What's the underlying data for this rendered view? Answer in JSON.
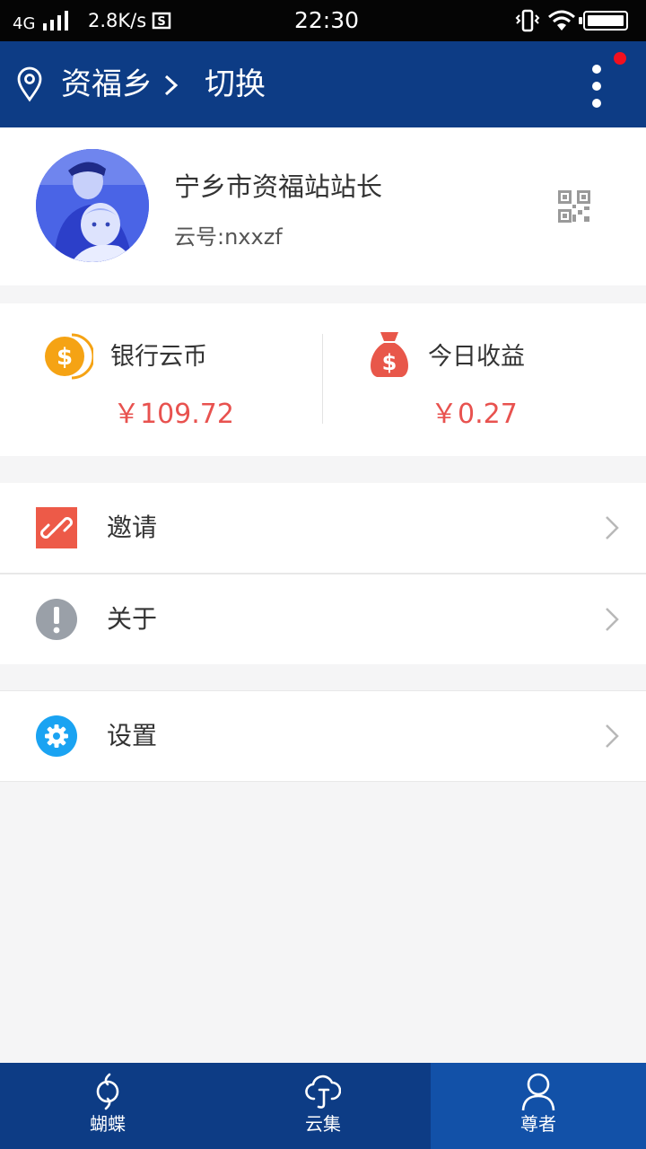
{
  "status_bar": {
    "network": "4G",
    "speed": "2.8K/s",
    "time": "22:30"
  },
  "header": {
    "location": "资福乡",
    "switch_label": "切换"
  },
  "profile": {
    "name": "宁乡市资福站站长",
    "cloud_id": "云号:nxxzf"
  },
  "wallet": {
    "coin_label": "银行云币",
    "coin_value": "￥109.72",
    "income_label": "今日收益",
    "income_value": "￥0.27"
  },
  "menu": {
    "invite": "邀请",
    "about": "关于",
    "settings": "设置"
  },
  "tabs": [
    {
      "label": "蝴蝶",
      "icon": "butterfly-icon",
      "active": false
    },
    {
      "label": "云集",
      "icon": "cloud-icon",
      "active": false
    },
    {
      "label": "尊者",
      "icon": "user-icon",
      "active": true
    }
  ],
  "colors": {
    "header_bg": "#0d3c85",
    "tab_active_bg": "#1251a8",
    "amount_red": "#e8524f",
    "coin_orange": "#f5a314",
    "bag_red": "#e8574a",
    "invite_red": "#ed5a48",
    "about_gray": "#9aa0a8",
    "settings_blue": "#1aa3f2",
    "notification_red": "#f2101f"
  }
}
